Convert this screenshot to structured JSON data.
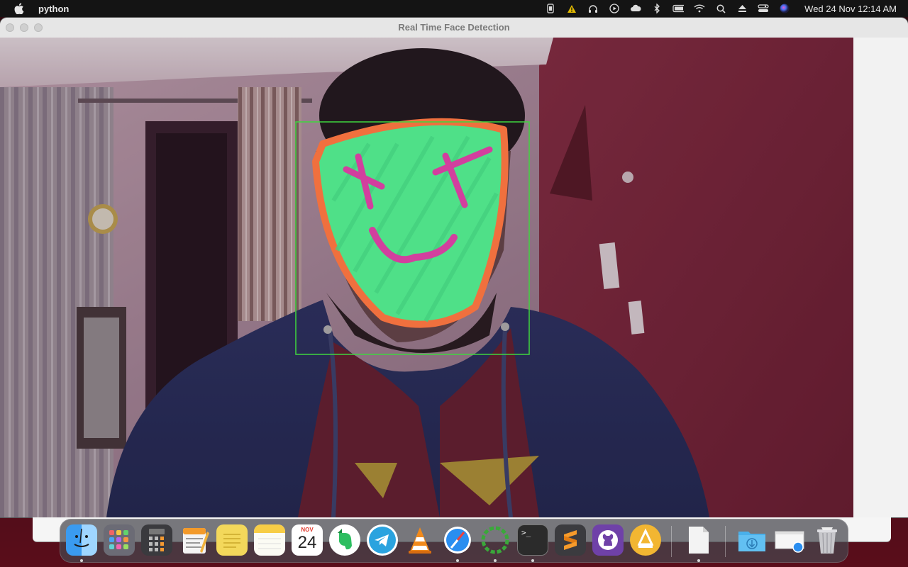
{
  "menubar": {
    "app_name": "python",
    "clock": "Wed 24 Nov  12:14 AM",
    "icons": [
      "apple-icon",
      "battery-status-icon",
      "warning-icon",
      "headphones-icon",
      "play-icon",
      "cloud-icon",
      "bluetooth-icon",
      "battery-icon",
      "wifi-icon",
      "search-icon",
      "eject-icon",
      "control-center-icon",
      "siri-icon"
    ]
  },
  "window": {
    "title": "Real Time Face Detection"
  },
  "detection": {
    "box_color": "#3fd63f",
    "face_overlay_colors": {
      "outline": "#f0703e",
      "fill": "#4fe088",
      "features": "#d23f9e"
    }
  },
  "dock": {
    "apps": [
      {
        "name": "Finder",
        "icon": "finder-icon",
        "running": true
      },
      {
        "name": "Launchpad",
        "icon": "launchpad-icon",
        "running": false
      },
      {
        "name": "Calculator",
        "icon": "calculator-icon",
        "running": false
      },
      {
        "name": "Pages",
        "icon": "pages-icon",
        "running": false
      },
      {
        "name": "Stickies",
        "icon": "stickies-icon",
        "running": false
      },
      {
        "name": "Notes",
        "icon": "notes-icon",
        "running": false
      },
      {
        "name": "Calendar",
        "icon": "calendar-icon",
        "running": false,
        "month": "NOV",
        "day": "24"
      },
      {
        "name": "Evernote",
        "icon": "evernote-icon",
        "running": false
      },
      {
        "name": "Telegram",
        "icon": "telegram-icon",
        "running": false
      },
      {
        "name": "VLC",
        "icon": "vlc-icon",
        "running": false
      },
      {
        "name": "Safari",
        "icon": "safari-icon",
        "running": true
      },
      {
        "name": "Python Launcher",
        "icon": "loading-ring-icon",
        "running": true
      },
      {
        "name": "Terminal",
        "icon": "terminal-icon",
        "running": true
      },
      {
        "name": "Sublime Text",
        "icon": "sublime-icon",
        "running": false
      },
      {
        "name": "GitHub Desktop",
        "icon": "github-icon",
        "running": false
      },
      {
        "name": "Cleaner",
        "icon": "cleaner-icon",
        "running": false
      },
      {
        "name": "Document",
        "icon": "document-icon",
        "running": true
      },
      {
        "name": "Downloads",
        "icon": "downloads-folder-icon",
        "running": false
      },
      {
        "name": "Safari Window",
        "icon": "window-preview-icon",
        "running": false
      },
      {
        "name": "Trash",
        "icon": "trash-icon",
        "running": false
      }
    ],
    "terminal_prompt": ">_"
  }
}
